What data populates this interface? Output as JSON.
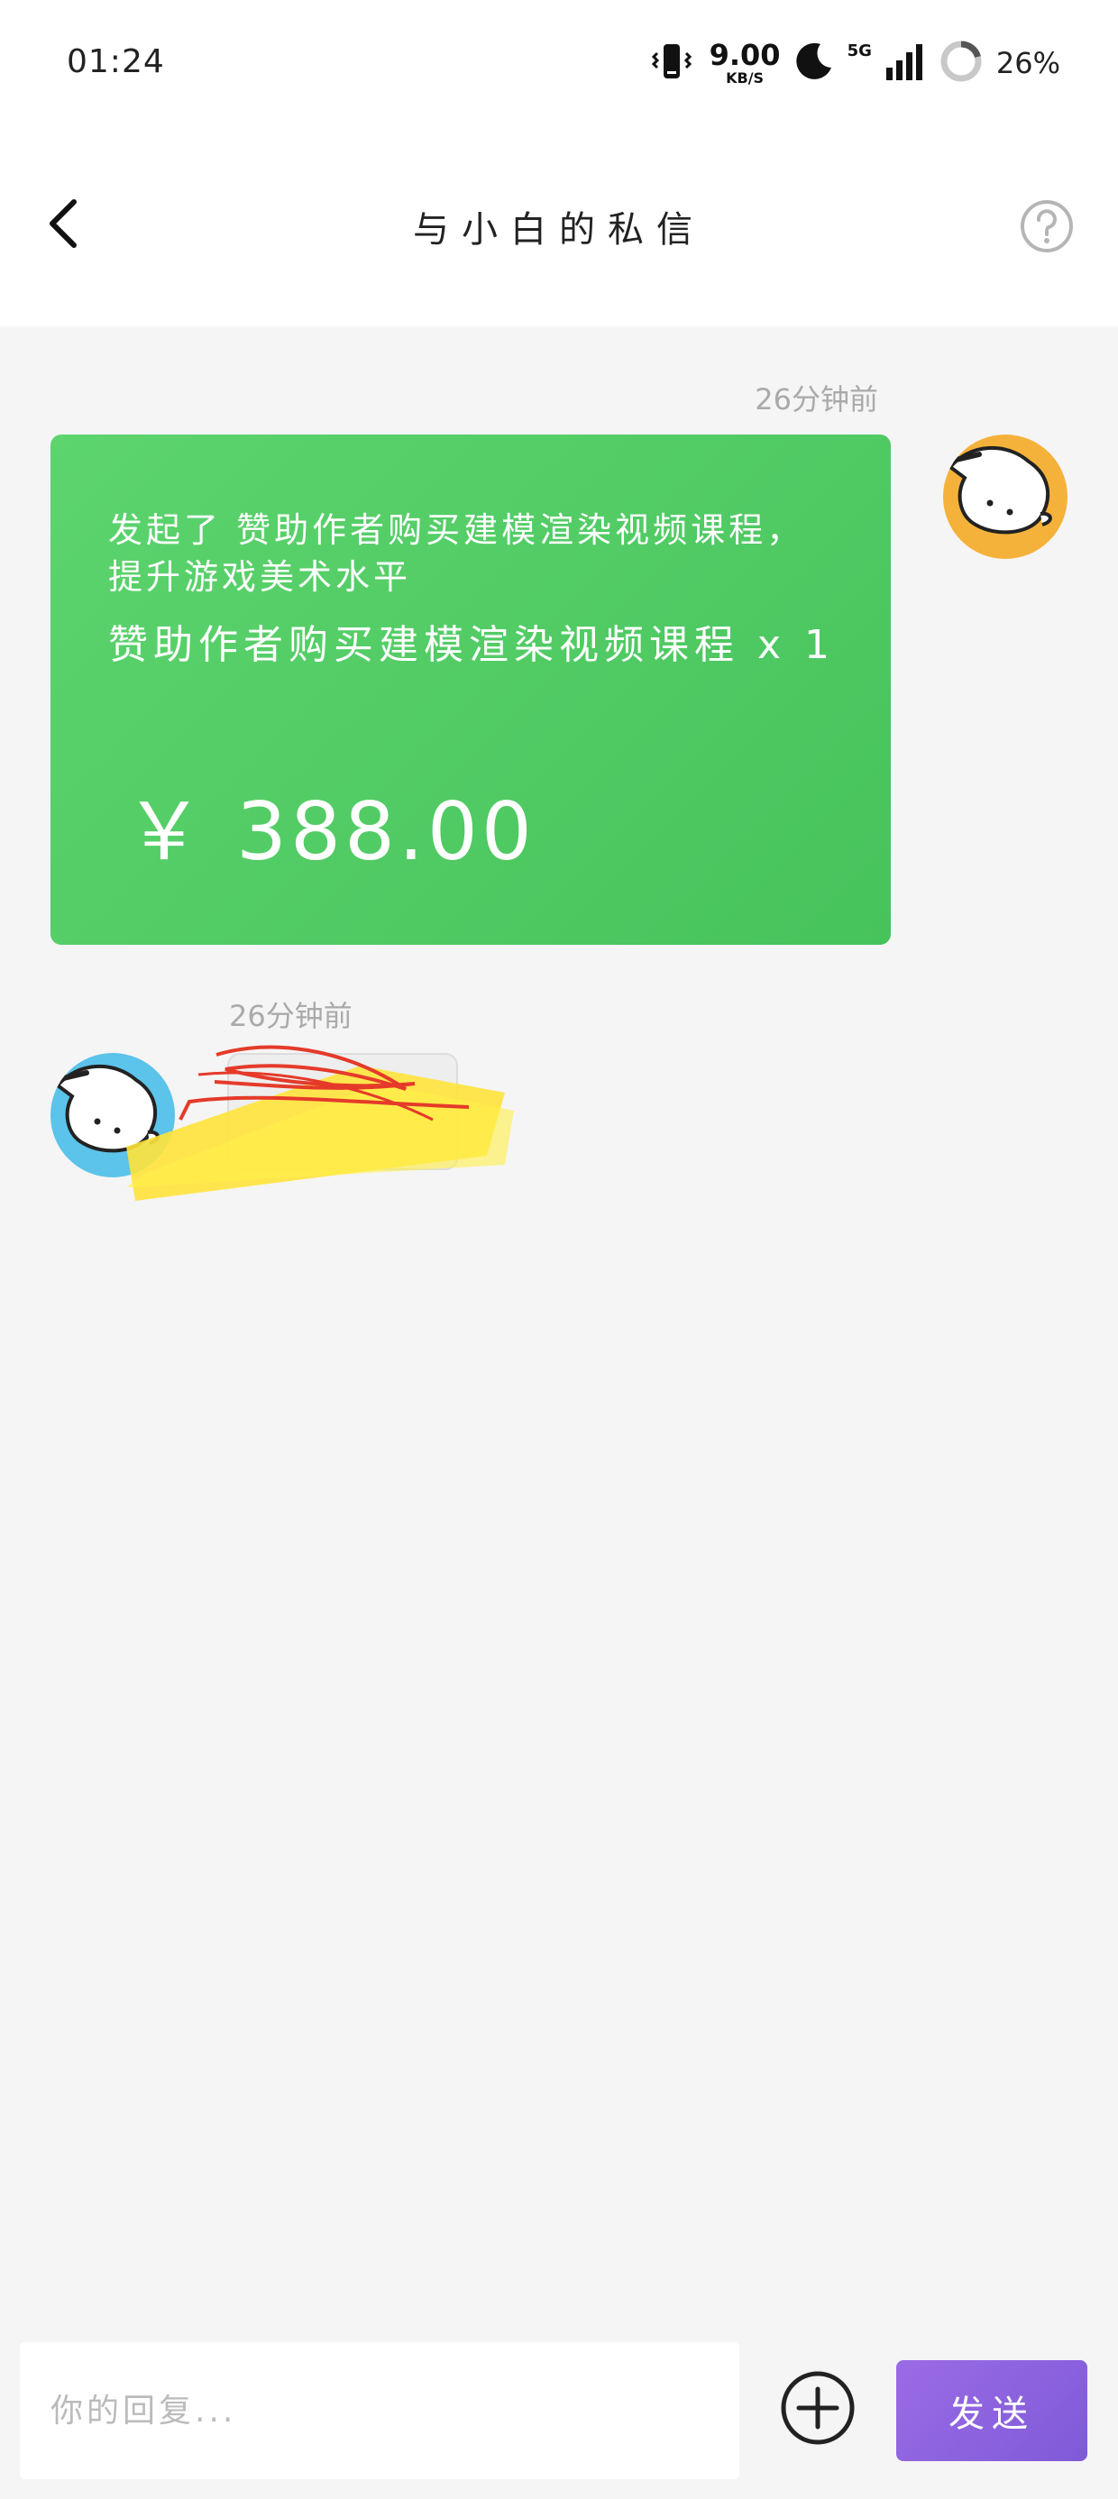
{
  "status_bar": {
    "time": "01:24",
    "net_speed": "9.00",
    "net_speed_unit": "KB/S",
    "network": "5G",
    "battery": "26%",
    "icons": [
      "vibrate-icon",
      "moon-icon",
      "signal-icon",
      "battery-ring-icon"
    ]
  },
  "header": {
    "title": "与小白的私信",
    "back_icon": "chevron-left-icon",
    "help_icon": "help-circle-icon"
  },
  "messages": [
    {
      "side": "right",
      "time": "26分钟前",
      "type": "gift",
      "line1": "发起了 赞助作者购买建模渲染视频课程，提升游戏美术水平",
      "line2": "赞助作者购买建模渲染视频课程 x 1",
      "price": "￥ 388.00"
    },
    {
      "side": "left",
      "time": "26分钟前",
      "type": "text",
      "content_redacted": true
    }
  ],
  "input": {
    "placeholder": "你的回复...",
    "send_label": "发送",
    "plus_icon": "plus-circle-icon"
  },
  "colors": {
    "gift_card": "#4fcb62",
    "send_button": "#8c63e0",
    "self_avatar": "#f5b23a",
    "other_avatar": "#5cc3ea",
    "background": "#f5f5f5"
  }
}
